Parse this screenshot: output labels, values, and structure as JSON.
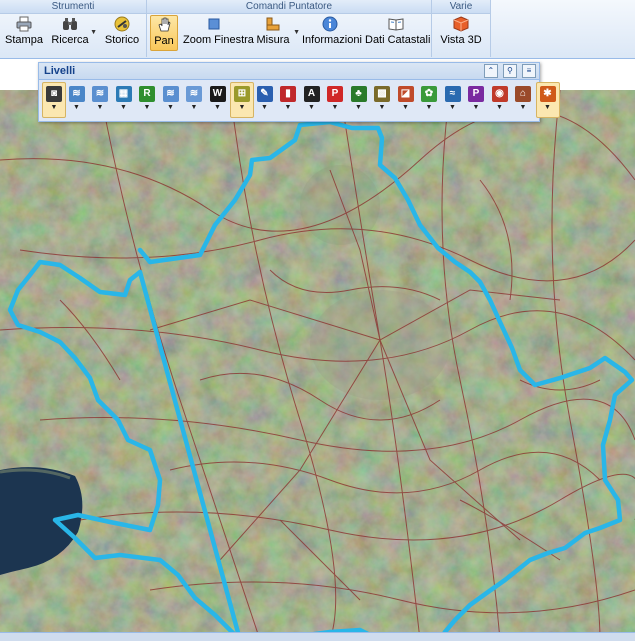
{
  "ribbon": {
    "groups": [
      {
        "title": "Strumenti",
        "buttons": [
          {
            "label": "Stampa",
            "icon": "printer-icon",
            "dropdown": false
          },
          {
            "label": "Ricerca",
            "icon": "binoculars-icon",
            "dropdown": true
          },
          {
            "label": "Storico",
            "icon": "history-icon",
            "dropdown": false
          }
        ]
      },
      {
        "title": "Comandi Puntatore",
        "buttons": [
          {
            "label": "Pan",
            "icon": "hand-icon",
            "dropdown": false,
            "active": true
          },
          {
            "label": "Zoom Finestra",
            "icon": "zoom-window-icon",
            "dropdown": false
          },
          {
            "label": "Misura",
            "icon": "ruler-icon",
            "dropdown": true
          },
          {
            "label": "Informazioni",
            "icon": "info-icon",
            "dropdown": false
          },
          {
            "label": "Dati Catastali",
            "icon": "book-icon",
            "dropdown": false
          }
        ]
      },
      {
        "title": "Varie",
        "buttons": [
          {
            "label": "Vista 3D",
            "icon": "cube-3d-icon",
            "dropdown": false
          }
        ]
      }
    ]
  },
  "livelli": {
    "title": "Livelli",
    "layers": [
      {
        "icon": "camera-icon",
        "glyph": "◙",
        "color": "#3a3a3a",
        "selected": true
      },
      {
        "icon": "layer-stack-icon",
        "glyph": "≋",
        "color": "#4a86c8"
      },
      {
        "icon": "layer-stack-icon",
        "glyph": "≋",
        "color": "#5a8fd0"
      },
      {
        "icon": "map-grid-icon",
        "glyph": "▦",
        "color": "#2c7bb6"
      },
      {
        "icon": "letter-r-icon",
        "glyph": "R",
        "color": "#2f8f2f"
      },
      {
        "icon": "layer-stack-icon",
        "glyph": "≋",
        "color": "#5a8fd0"
      },
      {
        "icon": "layer-stack-icon",
        "glyph": "≋",
        "color": "#6a9ad6"
      },
      {
        "icon": "letter-w-icon",
        "glyph": "W",
        "color": "#1a1a1a"
      },
      {
        "icon": "cadastral-icon",
        "glyph": "⊞",
        "color": "#9a9a2a",
        "selected": true
      },
      {
        "icon": "pin-icon",
        "glyph": "✎",
        "color": "#2a5fb0"
      },
      {
        "icon": "book-red-icon",
        "glyph": "▮",
        "color": "#c0282a"
      },
      {
        "icon": "letter-a-icon",
        "glyph": "A",
        "color": "#222222"
      },
      {
        "icon": "label-red-icon",
        "glyph": "P",
        "color": "#d02828"
      },
      {
        "icon": "tree-icon",
        "glyph": "♣",
        "color": "#2a7a2a"
      },
      {
        "icon": "grid-color-icon",
        "glyph": "▩",
        "color": "#7a6a2a"
      },
      {
        "icon": "zoning-icon",
        "glyph": "◪",
        "color": "#c04a2a"
      },
      {
        "icon": "leaf-icon",
        "glyph": "✿",
        "color": "#3a9a3a"
      },
      {
        "icon": "water-icon",
        "glyph": "≈",
        "color": "#2a6ab0"
      },
      {
        "icon": "label-purple-icon",
        "glyph": "P",
        "color": "#7a2aa0"
      },
      {
        "icon": "circle-target-icon",
        "glyph": "◉",
        "color": "#c03a2a"
      },
      {
        "icon": "house-icon",
        "glyph": "⌂",
        "color": "#9a4a2a"
      },
      {
        "icon": "network-icon",
        "glyph": "✱",
        "color": "#d05a1a",
        "selected": true
      }
    ]
  },
  "colors": {
    "boundary": "#29b6e8",
    "parcel_lines": "#8a2a2a",
    "ribbon_border": "#99bbe8",
    "lake": "#1c3550"
  }
}
